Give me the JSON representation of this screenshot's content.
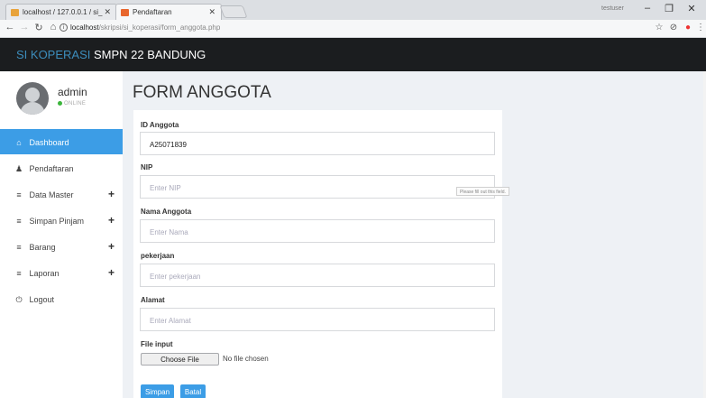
{
  "browser": {
    "tabs": [
      {
        "title": "localhost / 127.0.0.1 / si_",
        "favicon_color": "#e8a33b"
      },
      {
        "title": "Pendaftaran",
        "favicon_color": "#e8662d"
      }
    ],
    "url_host": "localhost",
    "url_path": "/skripsi/si_koperasi/form_anggota.php",
    "window_user": "testuser"
  },
  "header": {
    "brand_accent": "SI KOPERASI",
    "brand_rest": "SMPN 22 BANDUNG"
  },
  "user": {
    "name": "admin",
    "status": "ONLINE"
  },
  "sidebar": {
    "items": [
      {
        "label": "Dashboard",
        "icon": "home-icon",
        "glyph": "⌂",
        "has_plus": false
      },
      {
        "label": "Pendaftaran",
        "icon": "user-icon",
        "glyph": "♟",
        "has_plus": false
      },
      {
        "label": "Data Master",
        "icon": "list-icon",
        "glyph": "≡",
        "has_plus": true
      },
      {
        "label": "Simpan Pinjam",
        "icon": "list-icon",
        "glyph": "≡",
        "has_plus": true
      },
      {
        "label": "Barang",
        "icon": "list-icon",
        "glyph": "≡",
        "has_plus": true
      },
      {
        "label": "Laporan",
        "icon": "list-icon",
        "glyph": "≡",
        "has_plus": true
      },
      {
        "label": "Logout",
        "icon": "power-icon",
        "glyph": "⏻",
        "has_plus": false
      }
    ],
    "plus": "+"
  },
  "page": {
    "title": "FORM ANGGOTA"
  },
  "form": {
    "id_label": "ID Anggota",
    "id_value": "A25071839",
    "nip_label": "NIP",
    "nip_placeholder": "Enter NIP",
    "nama_label": "Nama Anggota",
    "nama_placeholder": "Enter Nama",
    "pekerjaan_label": "pekerjaan",
    "pekerjaan_placeholder": "Enter pekerjaan",
    "alamat_label": "Alamat",
    "alamat_placeholder": "Enter Alamat",
    "file_label": "File input",
    "file_button": "Choose File",
    "file_status": "No file chosen",
    "submit": "Simpan",
    "cancel": "Batal",
    "tooltip": "Please fill out this field."
  },
  "colors": {
    "accent": "#3c9de6",
    "header_bg": "#1b1d1f",
    "brand_accent": "#3c8dbc"
  }
}
